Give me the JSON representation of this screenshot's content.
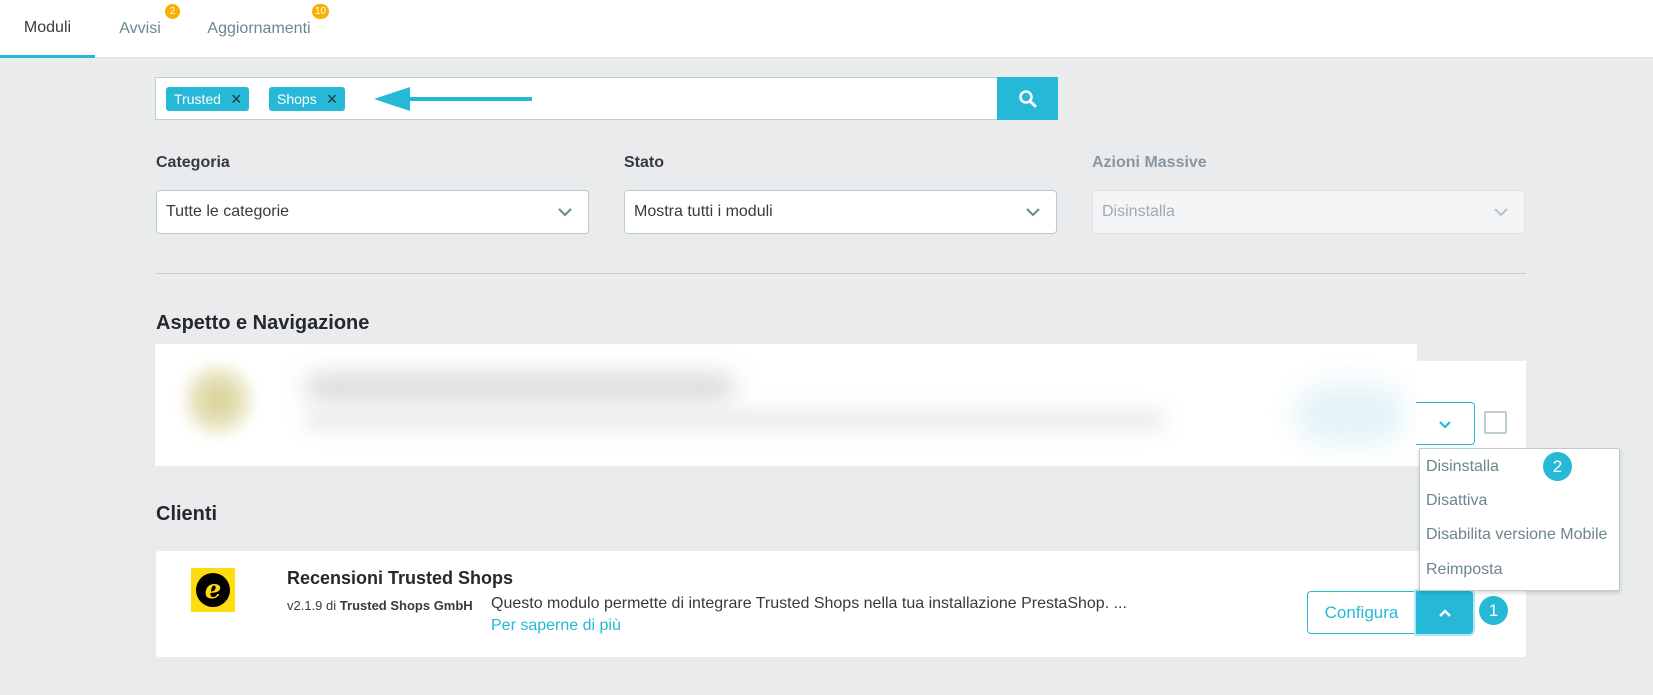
{
  "tabs": [
    {
      "label": "Moduli",
      "badge": ""
    },
    {
      "label": "Avvisi",
      "badge": "2"
    },
    {
      "label": "Aggiornamenti",
      "badge": "10"
    }
  ],
  "search": {
    "tags": [
      "Trusted",
      "Shops"
    ],
    "remove_icon": "×"
  },
  "filters": {
    "category_label": "Categoria",
    "category_value": "Tutte le categorie",
    "status_label": "Stato",
    "status_value": "Mostra tutti i moduli",
    "bulk_label": "Azioni Massive",
    "bulk_value": "Disinstalla"
  },
  "sections": {
    "first": "Aspetto e Navigazione",
    "second": "Clienti"
  },
  "menu": {
    "items": [
      "Disinstalla",
      "Disattiva",
      "Disabilita versione Mobile",
      "Reimposta"
    ]
  },
  "steps": {
    "one": "1",
    "two": "2"
  },
  "module": {
    "title": "Recensioni Trusted Shops",
    "version": "v2.1.9",
    "by": "di",
    "author": "Trusted Shops GmbH",
    "description": "Questo modulo permette di integrare Trusted Shops nella tua installazione PrestaShop. ...",
    "more_link": "Per saperne di più",
    "logo_letter": "e",
    "configure_label": "Configura"
  },
  "colors": {
    "accent": "#25b9d7",
    "badge": "#fab000",
    "logo_bg": "#ffdc0f"
  }
}
